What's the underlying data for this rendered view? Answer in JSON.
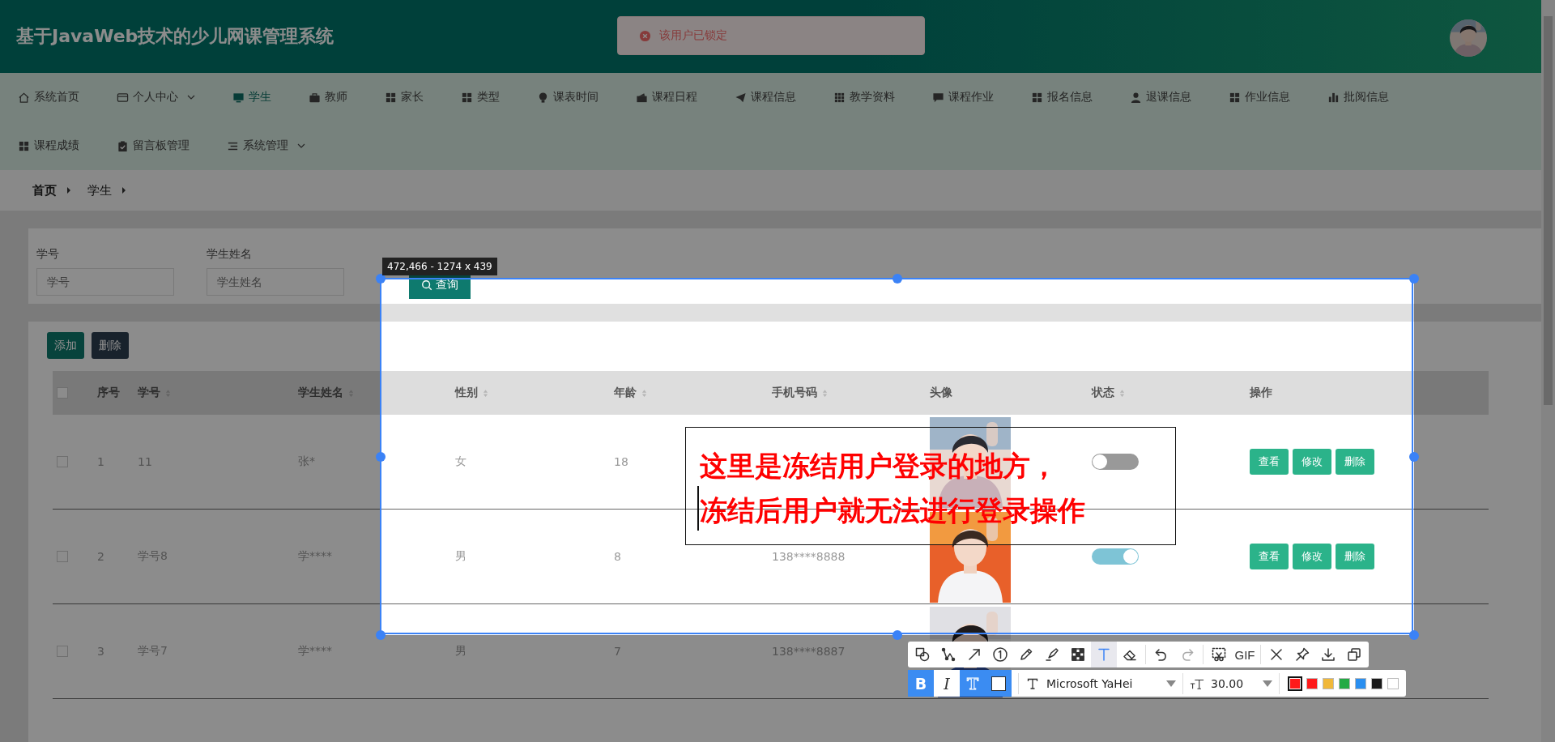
{
  "header": {
    "title": "基于JavaWeb技术的少儿网课管理系统"
  },
  "toast": {
    "kind": "error",
    "message": "该用户已锁定"
  },
  "nav": {
    "rows": [
      [
        {
          "label": "系统首页",
          "selected": false,
          "dropdown": false
        },
        {
          "label": "个人中心",
          "selected": false,
          "dropdown": true
        },
        {
          "label": "学生",
          "selected": true,
          "dropdown": false
        },
        {
          "label": "教师",
          "selected": false,
          "dropdown": false
        },
        {
          "label": "家长",
          "selected": false,
          "dropdown": false
        },
        {
          "label": "类型",
          "selected": false,
          "dropdown": false
        },
        {
          "label": "课表时间",
          "selected": false,
          "dropdown": false
        },
        {
          "label": "课程日程",
          "selected": false,
          "dropdown": false
        },
        {
          "label": "课程信息",
          "selected": false,
          "dropdown": false
        },
        {
          "label": "教学资料",
          "selected": false,
          "dropdown": false
        },
        {
          "label": "课程作业",
          "selected": false,
          "dropdown": false
        },
        {
          "label": "报名信息",
          "selected": false,
          "dropdown": false
        },
        {
          "label": "退课信息",
          "selected": false,
          "dropdown": false
        },
        {
          "label": "作业信息",
          "selected": false,
          "dropdown": false
        },
        {
          "label": "批阅信息",
          "selected": false,
          "dropdown": false
        }
      ],
      [
        {
          "label": "课程成绩",
          "selected": false,
          "dropdown": false
        },
        {
          "label": "留言板管理",
          "selected": false,
          "dropdown": false
        },
        {
          "label": "系统管理",
          "selected": false,
          "dropdown": true
        }
      ]
    ]
  },
  "breadcrumb": [
    "首页",
    "学生"
  ],
  "search": {
    "fields": [
      {
        "label": "学号",
        "placeholder": "学号"
      },
      {
        "label": "学生姓名",
        "placeholder": "学生姓名"
      }
    ],
    "button": "查询"
  },
  "actions": [
    {
      "label": "添加",
      "kind": "primary"
    },
    {
      "label": "删除",
      "kind": "dark"
    }
  ],
  "table": {
    "select_all_checked": false,
    "columns": [
      {
        "label": "序号",
        "sortable": false
      },
      {
        "label": "学号",
        "sortable": true
      },
      {
        "label": "学生姓名",
        "sortable": true
      },
      {
        "label": "性别",
        "sortable": true
      },
      {
        "label": "年龄",
        "sortable": true
      },
      {
        "label": "手机号码",
        "sortable": true
      },
      {
        "label": "头像",
        "sortable": false
      },
      {
        "label": "状态",
        "sortable": true
      },
      {
        "label": "操作",
        "sortable": false
      }
    ],
    "rows": [
      {
        "checked": false,
        "index": "1",
        "id": "11",
        "name": "张*",
        "gender": "女",
        "age": "18",
        "status": {
          "on": false
        },
        "actions": [
          "查看",
          "修改",
          "删除"
        ]
      },
      {
        "checked": false,
        "index": "2",
        "id": "学号8",
        "name": "学****",
        "gender": "男",
        "age": "8",
        "phone": "138****8888",
        "status": {
          "on": true
        },
        "actions": [
          "查看",
          "修改",
          "删除"
        ]
      },
      {
        "checked": false,
        "index": "3",
        "id": "学号7",
        "name": "学****",
        "gender": "男",
        "age": "7",
        "phone": "138****8887"
      }
    ]
  },
  "capture": {
    "size_label": "472,466 - 1274 x 439",
    "annotation": {
      "lines": [
        "这里是冻结用户登录的地方，",
        "冻结后用户就无法进行登录操作"
      ]
    },
    "toolbar": {
      "tool_groups": [
        [
          {
            "selected": false,
            "disabled": false
          },
          {
            "selected": false,
            "disabled": false
          },
          {
            "selected": false,
            "disabled": false
          },
          {
            "selected": false,
            "disabled": false
          },
          {
            "selected": false,
            "disabled": false
          },
          {
            "selected": false,
            "disabled": false
          },
          {
            "selected": false,
            "disabled": false
          },
          {
            "selected": true,
            "disabled": false
          },
          {
            "selected": false,
            "disabled": false
          }
        ],
        [
          {
            "selected": false,
            "disabled": false
          },
          {
            "selected": false,
            "disabled": true
          }
        ],
        [
          {
            "selected": false,
            "disabled": false
          },
          {
            "label": "GIF",
            "selected": false,
            "disabled": false
          }
        ],
        [
          {
            "selected": false,
            "disabled": false
          },
          {
            "selected": false,
            "disabled": false
          },
          {
            "selected": false,
            "disabled": false
          },
          {
            "selected": false,
            "disabled": false
          }
        ]
      ],
      "format": [
        {
          "kind": "bold",
          "label": "B",
          "selected": true
        },
        {
          "kind": "italic",
          "label": "I",
          "selected": false
        },
        {
          "kind": "outline",
          "label": "T",
          "selected": true
        },
        {
          "kind": "fill",
          "selected": true
        }
      ],
      "font": "Microsoft YaHei",
      "size": "30.00",
      "colors": [
        {
          "color": "#ff1a1a",
          "selected": true
        },
        {
          "color": "#ff1a1a",
          "selected": false
        },
        {
          "color": "#f0b83a",
          "selected": false
        },
        {
          "color": "#22aa44",
          "selected": false
        },
        {
          "color": "#2a8ff0",
          "selected": false
        },
        {
          "color": "#1a1a1a",
          "selected": false
        },
        {
          "color": "#ffffff",
          "selected": false
        }
      ]
    }
  }
}
